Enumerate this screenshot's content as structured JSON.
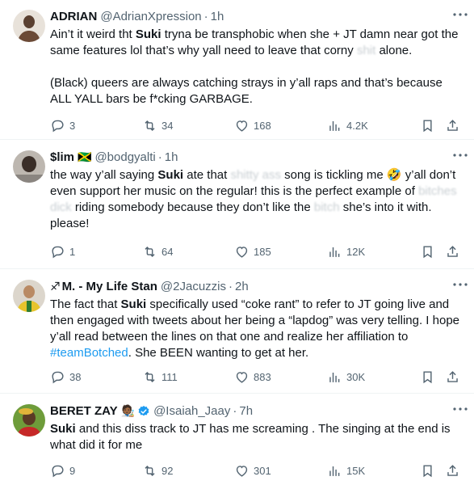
{
  "tweets": [
    {
      "name": "ADRIAN",
      "handle": "@AdrianXpression",
      "dot": "·",
      "time": "1h",
      "text_1": "Ain’t it weird tht ",
      "text_bold": "Suki",
      "text_2": " tryna be transphobic when she + JT damn near got the same features lol that’s why yall need to leave that corny ",
      "text_blur": "shit",
      "text_3": " alone.\n\n(Black) queers are always catching strays in y’all raps and that’s because ALL YALL bars be f*cking GARBAGE.",
      "replies": "3",
      "reposts": "34",
      "likes": "168",
      "views": "4.2K"
    },
    {
      "name": "$lim",
      "flag": "🇯🇲",
      "handle": "@bodgyalti",
      "dot": "·",
      "time": "1h",
      "text_1": "the way y’all saying ",
      "text_bold": "Suki",
      "text_2": " ate that ",
      "text_blur": "shitty ass",
      "text_3": " song is tickling me ",
      "emoji": "🤣",
      "text_4": " y’all don’t even support her music on the regular! this is the perfect example of ",
      "text_blur2": "bitches dick",
      "text_5": " riding somebody because they don’t like the ",
      "text_blur3": "bitch",
      "text_6": " she’s into it with. please!",
      "replies": "1",
      "reposts": "64",
      "likes": "185",
      "views": "12K"
    },
    {
      "name": "M. - My Life Stan",
      "zodiac": "♐",
      "handle": "@2Jacuzzis",
      "dot": "·",
      "time": "2h",
      "text_1": "The fact that ",
      "text_bold": "Suki",
      "text_2": " specifically used “coke rant” to refer to JT going live and then engaged with tweets about her being a “lapdog” was very telling. I hope y’all read between the lines on that one and realize her affiliation to ",
      "hashtag": "#teamBotched",
      "text_3": ". She BEEN wanting to get at her.",
      "replies": "38",
      "reposts": "111",
      "likes": "883",
      "views": "30K"
    },
    {
      "name": "BERET ZAY",
      "emoji": "🧑🏾‍🎨",
      "handle": "@Isaiah_Jaay",
      "dot": "·",
      "time": "7h",
      "text_bold": "Suki",
      "text_2": " and this diss track to JT has me screaming . The singing at the end is what did it for me",
      "replies": "9",
      "reposts": "92",
      "likes": "301",
      "views": "15K"
    }
  ],
  "icons": {
    "more": "more-horizontal-icon",
    "reply": "reply-icon",
    "repost": "repost-icon",
    "like": "heart-icon",
    "views": "views-chart-icon",
    "bookmark": "bookmark-icon",
    "share": "share-icon",
    "verified": "verified-badge-icon"
  },
  "colors": {
    "text": "#0f1419",
    "secondary": "#536471",
    "link": "#1d9bf0",
    "divider": "#eff3f4"
  }
}
